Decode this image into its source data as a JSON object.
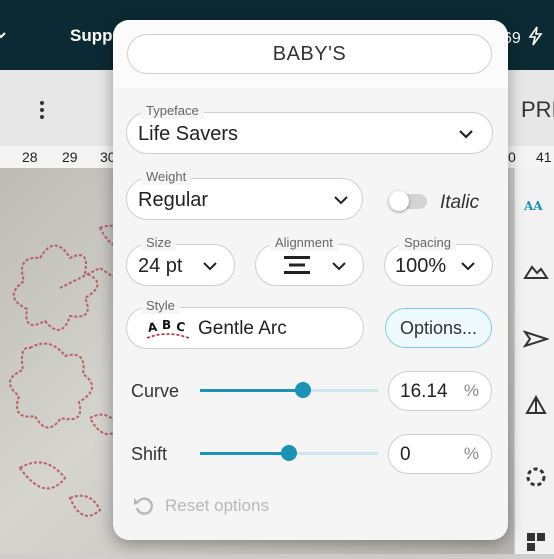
{
  "app": {
    "topbar_label": "Supp",
    "topbar_number": "69",
    "toolbar_right_label": "PRI",
    "ruler_ticks": [
      "28",
      "29",
      "30",
      "0",
      "41"
    ]
  },
  "popup": {
    "text_value": "BABY'S",
    "typeface": {
      "label": "Typeface",
      "value": "Life Savers"
    },
    "weight": {
      "label": "Weight",
      "value": "Regular"
    },
    "italic": {
      "label": "Italic",
      "enabled": false
    },
    "size": {
      "label": "Size",
      "value": "24 pt"
    },
    "alignment": {
      "label": "Alignment",
      "icon": "align-center-icon"
    },
    "spacing": {
      "label": "Spacing",
      "value": "100%"
    },
    "style": {
      "label": "Style",
      "preview_text": "ABC",
      "value": "Gentle Arc"
    },
    "options_button": "Options...",
    "curve": {
      "label": "Curve",
      "value": "16.14",
      "unit": "%",
      "slider_fraction": 0.58
    },
    "shift": {
      "label": "Shift",
      "value": "0",
      "unit": "%",
      "slider_fraction": 0.5
    },
    "reset_label": "Reset options"
  },
  "colors": {
    "accent": "#1a93b5",
    "topbar": "#0c2a33",
    "preview_red": "#cc2233"
  }
}
